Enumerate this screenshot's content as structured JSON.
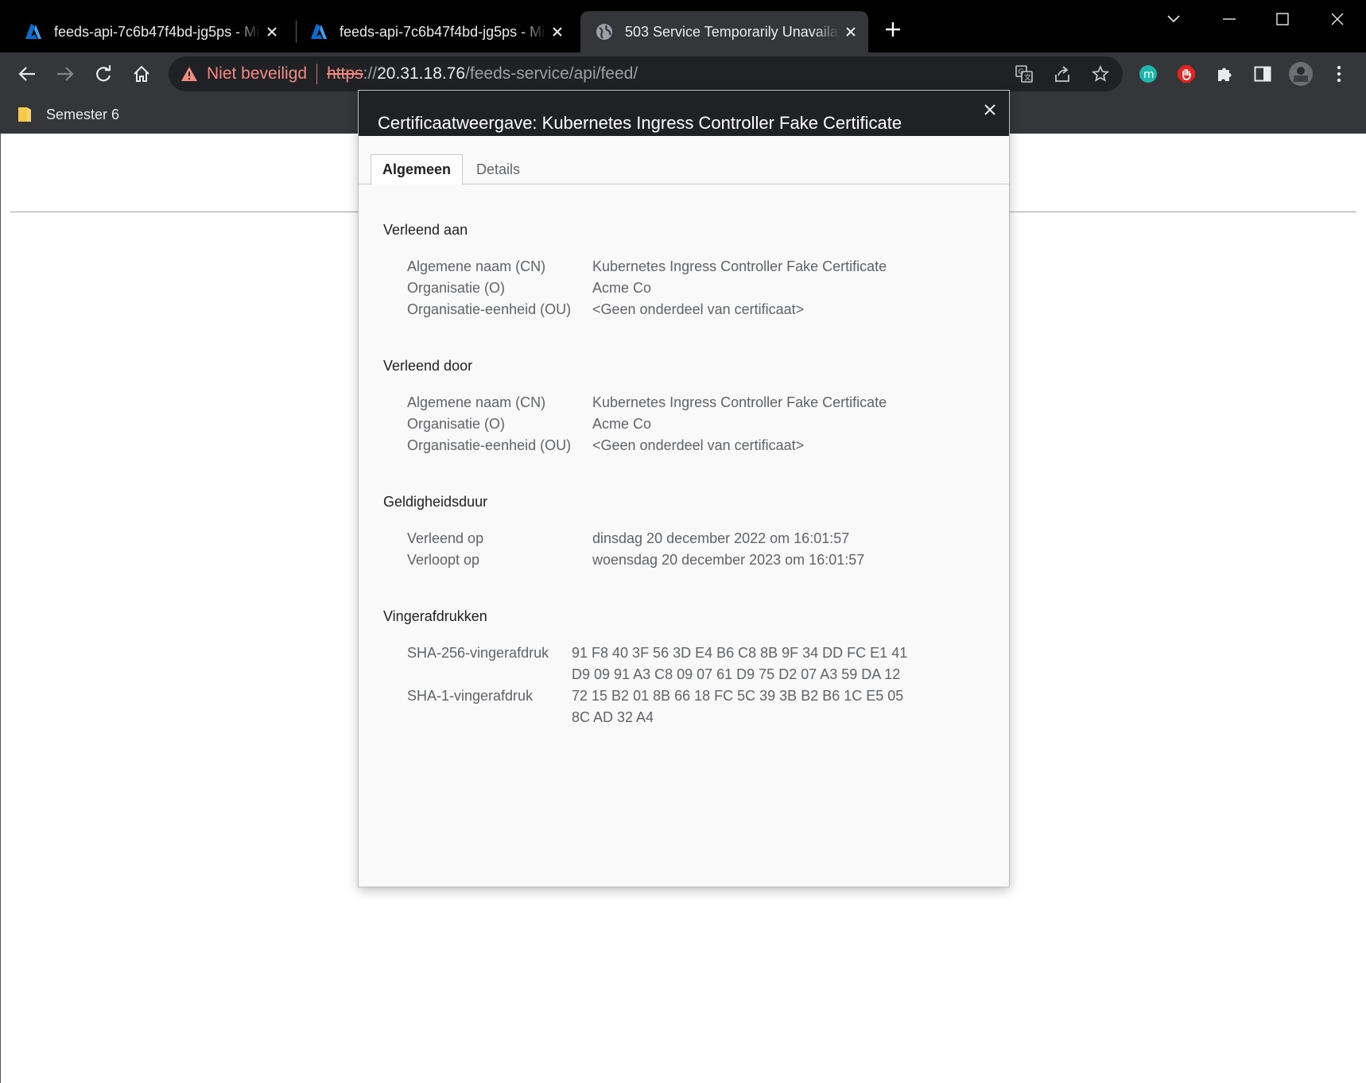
{
  "browser": {
    "tabs": [
      {
        "title": "feeds-api-7c6b47f4bd-jg5ps - Mi",
        "icon": "azure-icon",
        "active": false
      },
      {
        "title": "feeds-api-7c6b47f4bd-jg5ps - Mi",
        "icon": "azure-icon",
        "active": false
      },
      {
        "title": "503 Service Temporarily Unavailal",
        "icon": "globe-icon",
        "active": true
      }
    ],
    "omnibox": {
      "security_label": "Niet beveiligd",
      "scheme": "https",
      "separator": "://",
      "host": "20.31.18.76",
      "path": "/feeds-service/api/feed/"
    },
    "bookmarks": [
      {
        "label": "Semester 6"
      }
    ],
    "colors": {
      "tabstrip": "#000000",
      "toolbar": "#35363a",
      "omnibox": "#202124",
      "warning": "#f28b82",
      "extension_teal": "#1fb5ad",
      "extension_red": "#e52421"
    }
  },
  "dialog": {
    "title": "Certificaatweergave: Kubernetes Ingress Controller Fake Certificate",
    "tabs": [
      {
        "label": "Algemeen",
        "selected": true
      },
      {
        "label": "Details",
        "selected": false
      }
    ],
    "issued_to": {
      "heading": "Verleend aan",
      "rows": [
        {
          "label": "Algemene naam (CN)",
          "value": "Kubernetes Ingress Controller Fake Certificate"
        },
        {
          "label": "Organisatie (O)",
          "value": "Acme Co"
        },
        {
          "label": "Organisatie-eenheid (OU)",
          "value": "<Geen onderdeel van certificaat>"
        }
      ]
    },
    "issued_by": {
      "heading": "Verleend door",
      "rows": [
        {
          "label": "Algemene naam (CN)",
          "value": "Kubernetes Ingress Controller Fake Certificate"
        },
        {
          "label": "Organisatie (O)",
          "value": "Acme Co"
        },
        {
          "label": "Organisatie-eenheid (OU)",
          "value": "<Geen onderdeel van certificaat>"
        }
      ]
    },
    "validity": {
      "heading": "Geldigheidsduur",
      "rows": [
        {
          "label": "Verleend op",
          "value": "dinsdag 20 december 2022 om 16:01:57"
        },
        {
          "label": "Verloopt op",
          "value": "woensdag 20 december 2023 om 16:01:57"
        }
      ]
    },
    "fingerprints": {
      "heading": "Vingerafdrukken",
      "sha256": {
        "label": "SHA-256-vingerafdruk",
        "line1": "91 F8 40 3F 56 3D E4 B6 C8 8B 9F 34 DD FC E1 41",
        "line2": "D9 09 91 A3 C8 09 07 61 D9 75 D2 07 A3 59 DA 12"
      },
      "sha1": {
        "label": "SHA-1-vingerafdruk",
        "line1": "72 15 B2 01 8B 66 18 FC 5C 39 3B B2 B6 1C E5 05",
        "line2": "8C AD 32 A4"
      }
    }
  }
}
